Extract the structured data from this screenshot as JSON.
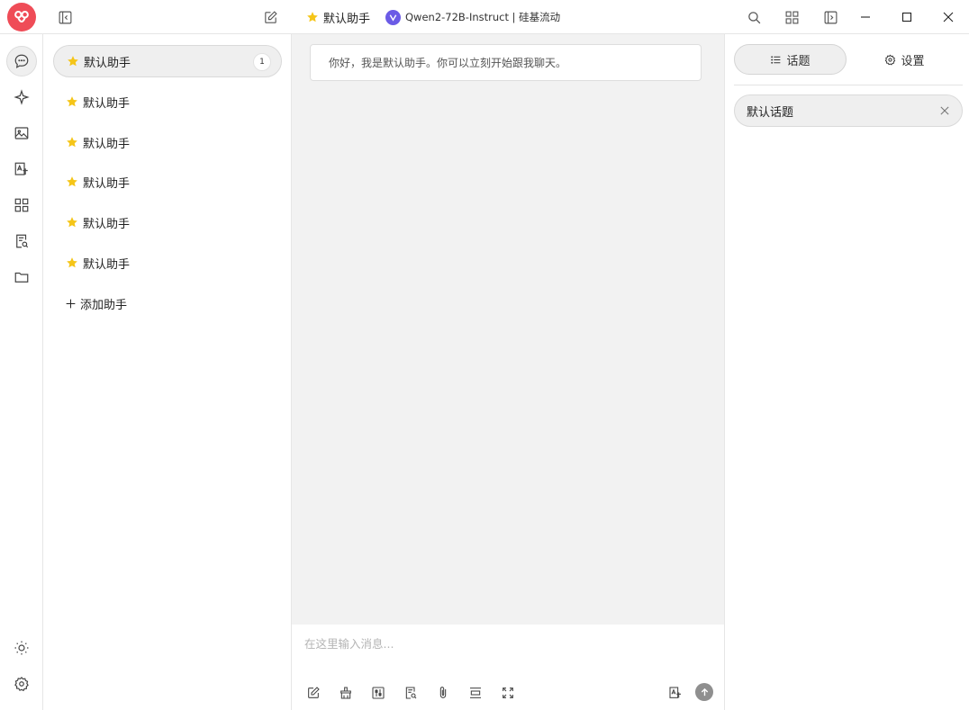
{
  "titlebar": {
    "assistant_name": "默认助手",
    "model_label": "Qwen2-72B-Instruct | 硅基流动"
  },
  "assistants": {
    "items": [
      {
        "label": "默认助手",
        "badge": "1",
        "active": true
      },
      {
        "label": "默认助手"
      },
      {
        "label": "默认助手"
      },
      {
        "label": "默认助手"
      },
      {
        "label": "默认助手"
      },
      {
        "label": "默认助手"
      }
    ],
    "add_label": "添加助手"
  },
  "chat": {
    "welcome": "你好，我是默认助手。你可以立刻开始跟我聊天。"
  },
  "composer": {
    "placeholder": "在这里输入消息..."
  },
  "right_panel": {
    "tab_topics": "话题",
    "tab_settings": "设置",
    "topics": [
      {
        "label": "默认话题"
      }
    ]
  },
  "colors": {
    "brand": "#ef4c57",
    "star": "#f5c518",
    "model_logo": "#6b5be6"
  }
}
